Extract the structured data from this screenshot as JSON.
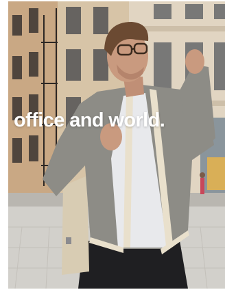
{
  "hero": {
    "headline": "office and world."
  },
  "colors": {
    "page_background": "#ffffff",
    "headline_text": "#ffffff",
    "jacket": "#8d8c86",
    "jacket_trim": "#e9e0cc",
    "tote_bag": "#d8ccb3",
    "tshirt": "#e8e9ec",
    "sky": "#dfe4e8"
  }
}
